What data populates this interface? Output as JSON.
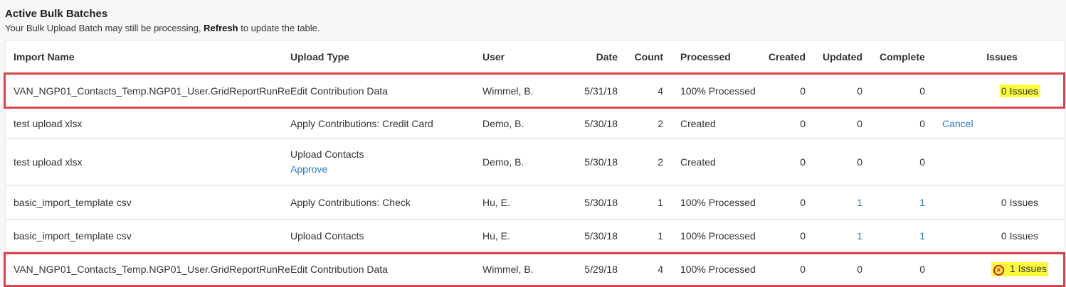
{
  "header": {
    "title": "Active Bulk Batches",
    "subtitle_prefix": "Your Bulk Upload Batch may still be processing, ",
    "subtitle_bold": "Refresh",
    "subtitle_suffix": " to update the table."
  },
  "columns": {
    "import_name": "Import Name",
    "upload_type": "Upload Type",
    "user": "User",
    "date": "Date",
    "count": "Count",
    "processed": "Processed",
    "created": "Created",
    "updated": "Updated",
    "complete": "Complete",
    "issues": "Issues"
  },
  "rows": [
    {
      "import_name": "VAN_NGP01_Contacts_Temp.NGP01_User.GridReportRunRe",
      "upload_type": "Edit Contribution Data",
      "action": "",
      "user": "Wimmel, B.",
      "date": "5/31/18",
      "count": "4",
      "processed": "100% Processed",
      "created": "0",
      "updated": "0",
      "complete": "0",
      "extra": "",
      "issues": "0 Issues"
    },
    {
      "import_name": "test upload xlsx",
      "upload_type": "Apply Contributions: Credit Card",
      "action": "",
      "user": "Demo, B.",
      "date": "5/30/18",
      "count": "2",
      "processed": "Created",
      "created": "0",
      "updated": "0",
      "complete": "0",
      "extra": "Cancel",
      "issues": ""
    },
    {
      "import_name": "test upload xlsx",
      "upload_type": "Upload Contacts",
      "action": "Approve",
      "user": "Demo, B.",
      "date": "5/30/18",
      "count": "2",
      "processed": "Created",
      "created": "0",
      "updated": "0",
      "complete": "0",
      "extra": "",
      "issues": ""
    },
    {
      "import_name": "basic_import_template csv",
      "upload_type": "Apply Contributions: Check",
      "action": "",
      "user": "Hu, E.",
      "date": "5/30/18",
      "count": "1",
      "processed": "100% Processed",
      "created": "0",
      "updated": "1",
      "complete": "1",
      "extra": "",
      "issues": "0 Issues"
    },
    {
      "import_name": "basic_import_template csv",
      "upload_type": "Upload Contacts",
      "action": "",
      "user": "Hu, E.",
      "date": "5/30/18",
      "count": "1",
      "processed": "100% Processed",
      "created": "0",
      "updated": "1",
      "complete": "1",
      "extra": "",
      "issues": "0 Issues"
    },
    {
      "import_name": "VAN_NGP01_Contacts_Temp.NGP01_User.GridReportRunRe",
      "upload_type": "Edit Contribution Data",
      "action": "",
      "user": "Wimmel, B.",
      "date": "5/29/18",
      "count": "4",
      "processed": "100% Processed",
      "created": "0",
      "updated": "0",
      "complete": "0",
      "extra": "",
      "issues": "1 Issues"
    }
  ],
  "error_icon": "error-circle-x-icon",
  "colors": {
    "highlight": "#fbfb3c",
    "annotation_box": "#d9434a",
    "link": "#2a7ac0"
  }
}
